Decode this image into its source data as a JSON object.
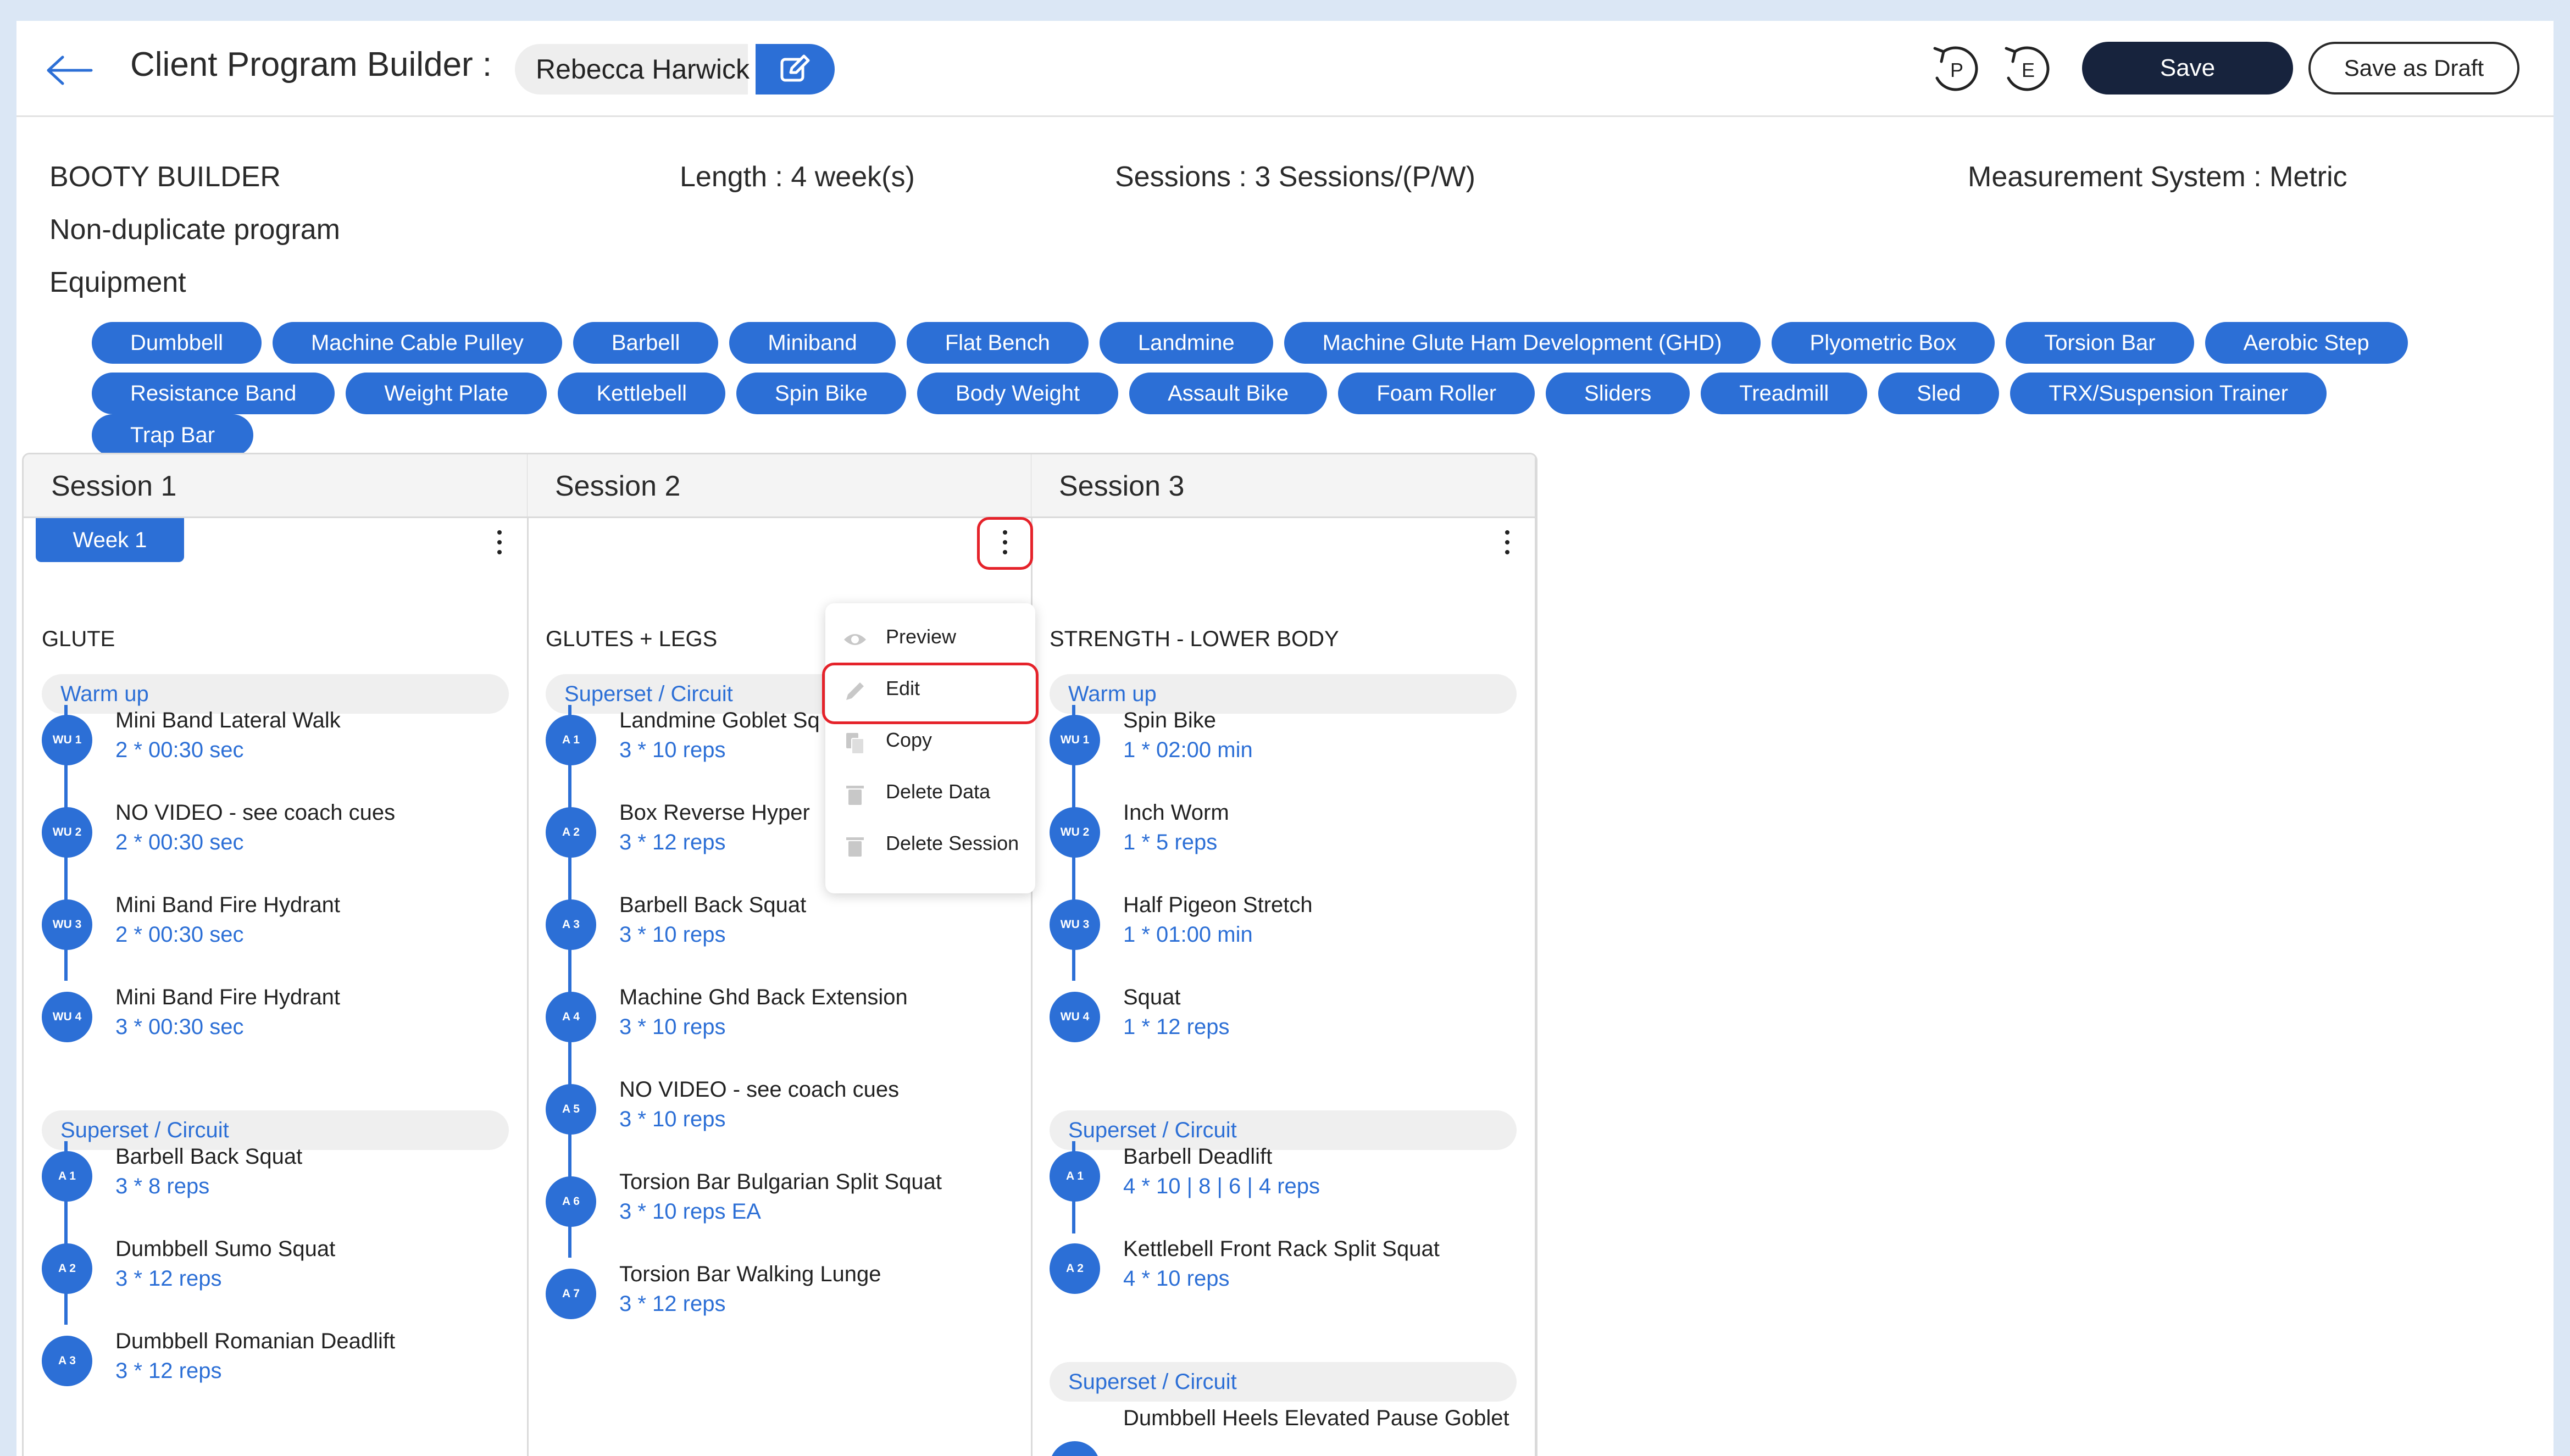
{
  "header": {
    "title": "Client Program Builder :",
    "client_name": "Rebecca Harwick",
    "history_p": "P",
    "history_e": "E",
    "save_label": "Save",
    "draft_label": "Save as Draft"
  },
  "program": {
    "name": "BOOTY BUILDER",
    "duplicate_status": "Non-duplicate program",
    "equipment_label": "Equipment",
    "length": "Length : 4 week(s)",
    "sessions": "Sessions : 3 Sessions/(P/W)",
    "measurement": "Measurement System : Metric"
  },
  "equipment": [
    "Dumbbell",
    "Machine Cable Pulley",
    "Barbell",
    "Miniband",
    "Flat Bench",
    "Landmine",
    "Machine Glute Ham Development (GHD)",
    "Plyometric Box",
    "Torsion Bar",
    "Aerobic Step",
    "Resistance Band",
    "Weight Plate",
    "Kettlebell",
    "Spin Bike",
    "Body Weight",
    "Assault Bike",
    "Foam Roller",
    "Sliders",
    "Treadmill",
    "Sled",
    "TRX/Suspension Trainer",
    "Trap Bar"
  ],
  "week_label": "Week 1",
  "sessions": [
    {
      "name": "Session 1",
      "title": "GLUTE",
      "sections": [
        {
          "label": "Warm up",
          "exercises": [
            {
              "code": "WU 1",
              "name": "Mini Band Lateral Walk",
              "detail": "2 * 00:30 sec"
            },
            {
              "code": "WU 2",
              "name": "NO VIDEO - see coach cues",
              "detail": "2 * 00:30 sec"
            },
            {
              "code": "WU 3",
              "name": "Mini Band Fire Hydrant",
              "detail": "2 * 00:30 sec"
            },
            {
              "code": "WU 4",
              "name": "Mini Band Fire Hydrant",
              "detail": "3 * 00:30 sec"
            }
          ]
        },
        {
          "label": "Superset / Circuit",
          "exercises": [
            {
              "code": "A 1",
              "name": "Barbell Back Squat",
              "detail": "3 * 8 reps"
            },
            {
              "code": "A 2",
              "name": "Dumbbell Sumo Squat",
              "detail": "3 * 12 reps"
            },
            {
              "code": "A 3",
              "name": "Dumbbell Romanian Deadlift",
              "detail": "3 * 12 reps"
            }
          ]
        }
      ]
    },
    {
      "name": "Session 2",
      "title": "GLUTES + LEGS",
      "sections": [
        {
          "label": "Superset / Circuit",
          "exercises": [
            {
              "code": "A 1",
              "name": "Landmine Goblet Sq",
              "detail": "3 * 10 reps"
            },
            {
              "code": "A 2",
              "name": "Box Reverse Hyper",
              "detail": "3 * 12 reps"
            },
            {
              "code": "A 3",
              "name": "Barbell Back Squat",
              "detail": "3 * 10 reps"
            },
            {
              "code": "A 4",
              "name": "Machine Ghd Back Extension",
              "detail": "3 * 10 reps"
            },
            {
              "code": "A 5",
              "name": "NO VIDEO - see coach cues",
              "detail": "3 * 10 reps"
            },
            {
              "code": "A 6",
              "name": "Torsion Bar Bulgarian Split Squat",
              "detail": "3 * 10 reps EA"
            },
            {
              "code": "A 7",
              "name": "Torsion Bar Walking Lunge",
              "detail": "3 * 12 reps"
            }
          ]
        }
      ]
    },
    {
      "name": "Session 3",
      "title": "STRENGTH - LOWER BODY",
      "sections": [
        {
          "label": "Warm up",
          "exercises": [
            {
              "code": "WU 1",
              "name": "Spin Bike",
              "detail": "1 * 02:00 min"
            },
            {
              "code": "WU 2",
              "name": "Inch Worm",
              "detail": "1 * 5 reps"
            },
            {
              "code": "WU 3",
              "name": "Half Pigeon Stretch",
              "detail": "1 * 01:00 min"
            },
            {
              "code": "WU 4",
              "name": "Squat",
              "detail": "1 * 12 reps"
            }
          ]
        },
        {
          "label": "Superset / Circuit",
          "exercises": [
            {
              "code": "A 1",
              "name": "Barbell Deadlift",
              "detail": "4 * 10 | 8 | 6 | 4 reps"
            },
            {
              "code": "A 2",
              "name": "Kettlebell Front Rack Split Squat",
              "detail": "4 * 10 reps"
            }
          ]
        },
        {
          "label": "Superset / Circuit",
          "exercises": [
            {
              "code": "",
              "name": "Dumbbell Heels Elevated Pause Goblet",
              "detail": ""
            }
          ]
        }
      ]
    }
  ],
  "context_menu": {
    "items": [
      {
        "label": "Preview",
        "icon": "eye-icon"
      },
      {
        "label": "Edit",
        "icon": "pencil-icon"
      },
      {
        "label": "Copy",
        "icon": "copy-icon"
      },
      {
        "label": "Delete Data",
        "icon": "trash-icon"
      },
      {
        "label": "Delete Session",
        "icon": "trash-icon"
      }
    ]
  },
  "colors": {
    "accent": "#2c6fd6",
    "primary_button": "#17233d",
    "highlight": "#e5222a"
  }
}
